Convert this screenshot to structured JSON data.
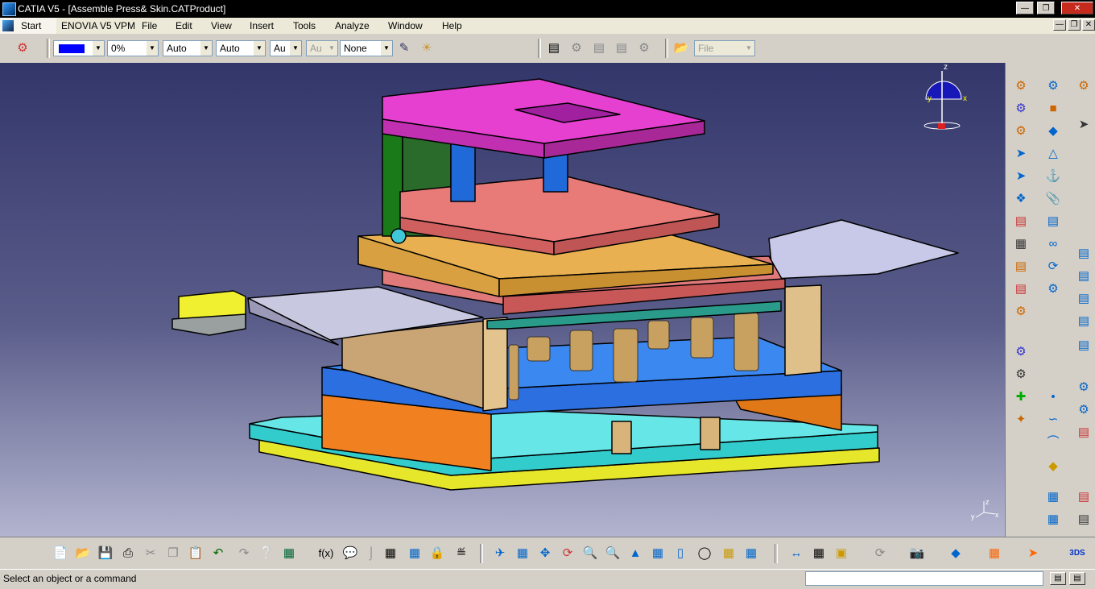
{
  "window": {
    "title": "CATIA V5 - [Assemble Press& Skin.CATProduct]"
  },
  "menu": {
    "start": "Start",
    "items": [
      "ENOVIA V5 VPM",
      "File",
      "Edit",
      "View",
      "Insert",
      "Tools",
      "Analyze",
      "Window",
      "Help"
    ]
  },
  "toolbar": {
    "color_value": "",
    "transparency": "0%",
    "line_thickness": "Auto",
    "line_type": "Auto",
    "point_type": "Au",
    "disabled_combo": "Au",
    "layer": "None",
    "file_combo": "File",
    "colors": {
      "swatch": "#0000ff"
    }
  },
  "status": {
    "message": "Select an object or a command",
    "command_input": ""
  },
  "compass": {
    "x": "x",
    "y": "y",
    "z": "z"
  },
  "axis": {
    "x": "x",
    "y": "y",
    "z": "z"
  }
}
